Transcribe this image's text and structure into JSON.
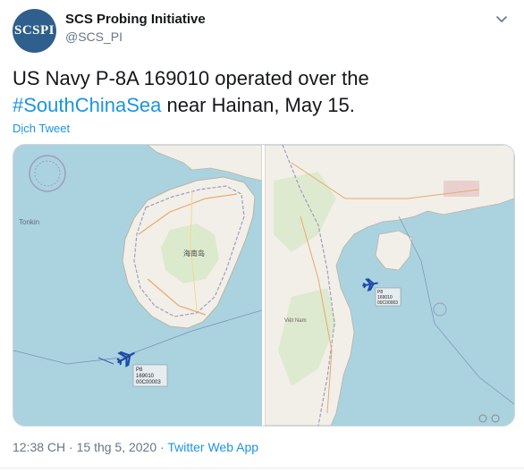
{
  "account": {
    "avatar_text": "SCSPI",
    "display_name": "SCS Probing Initiative",
    "handle": "@SCS_PI"
  },
  "tweet": {
    "text_before": "US Navy P-8A 169010 operated over the ",
    "hashtag": "#SouthChinaSea",
    "text_after": " near Hainan, May 15.",
    "translate_label": "Dịch Tweet"
  },
  "media": {
    "left_map": {
      "tonkin_label": "Tonkin",
      "island_label": "海南岛",
      "aircraft_tag_lines": [
        "P8",
        "169010",
        "00C00003"
      ]
    },
    "right_map": {
      "aircraft_tag_lines": [
        "P8",
        "169010",
        "00C00003"
      ],
      "region_label": "Việt Nam"
    }
  },
  "footer": {
    "time": "12:38 CH",
    "separator": " · ",
    "date": "15 thg 5, 2020",
    "via_separator": " · ",
    "source": "Twitter Web App"
  },
  "colors": {
    "link": "#1b95e0",
    "sea": "#aad3df",
    "land": "#f2efe9",
    "avatar_bg": "#2f5f8c"
  },
  "icons": {
    "chevron": "chevron-down-icon",
    "aircraft": "airplane-icon"
  }
}
